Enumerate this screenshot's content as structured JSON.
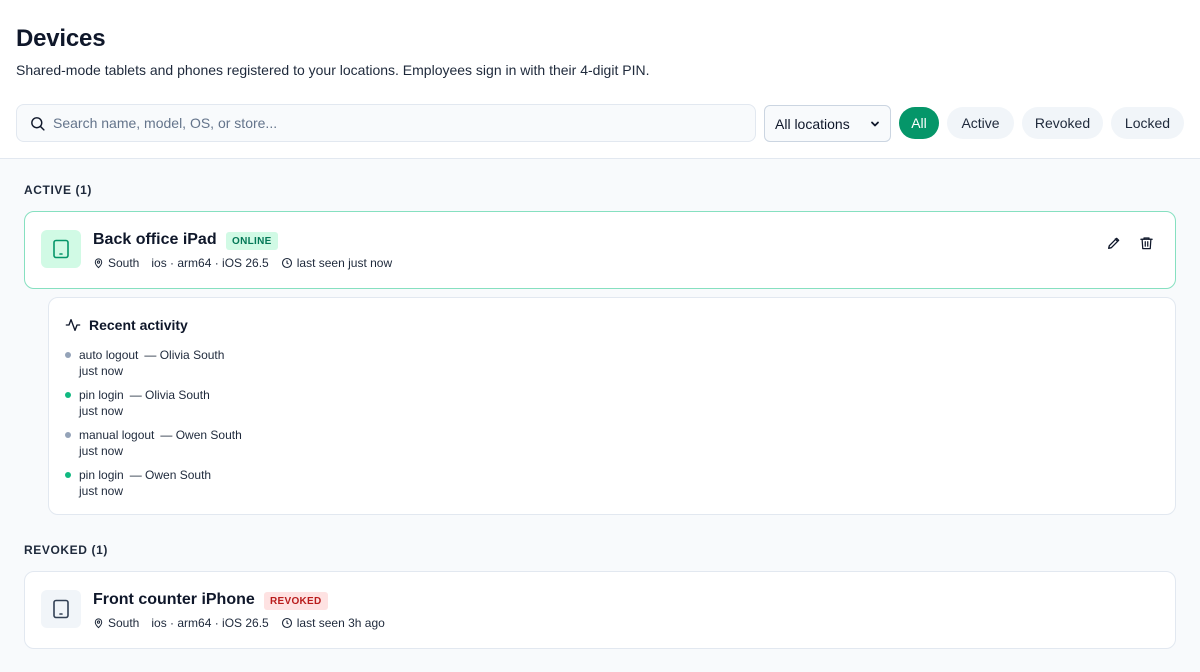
{
  "header": {
    "title": "Devices",
    "subtitle": "Shared-mode tablets and phones registered to your locations. Employees sign in with their 4-digit PIN."
  },
  "toolbar": {
    "search": {
      "placeholder": "Search name, model, OS, or store...",
      "value": ""
    },
    "location_select": {
      "selected": "All locations"
    },
    "filters": [
      {
        "label": "All",
        "active": true
      },
      {
        "label": "Active",
        "active": false
      },
      {
        "label": "Revoked",
        "active": false
      },
      {
        "label": "Locked",
        "active": false
      }
    ]
  },
  "sections": {
    "active": {
      "label": "ACTIVE (1)",
      "device": {
        "name": "Back office iPad",
        "status": "ONLINE",
        "location": "South",
        "platform": "ios · arm64 · iOS 26.5",
        "last_seen": "last seen just now",
        "icon": "tablet-icon"
      },
      "activity": {
        "title": "Recent activity",
        "items": [
          {
            "action": "auto logout",
            "who": "— Olivia South",
            "time": "just now",
            "status": "neutral"
          },
          {
            "action": "pin login",
            "who": "— Olivia South",
            "time": "just now",
            "status": "success"
          },
          {
            "action": "manual logout",
            "who": "— Owen South",
            "time": "just now",
            "status": "neutral"
          },
          {
            "action": "pin login",
            "who": "— Owen South",
            "time": "just now",
            "status": "success"
          }
        ]
      }
    },
    "revoked": {
      "label": "REVOKED (1)",
      "device": {
        "name": "Front counter iPhone",
        "status": "REVOKED",
        "location": "South",
        "platform": "ios · arm64 · iOS 26.5",
        "last_seen": "last seen 3h ago",
        "icon": "tablet-icon"
      }
    }
  },
  "colors": {
    "accent": "#059669",
    "online_badge_bg": "#d1fae5",
    "online_badge_text": "#047857",
    "revoked_badge_bg": "#fee2e2",
    "revoked_badge_text": "#b91c1c"
  }
}
